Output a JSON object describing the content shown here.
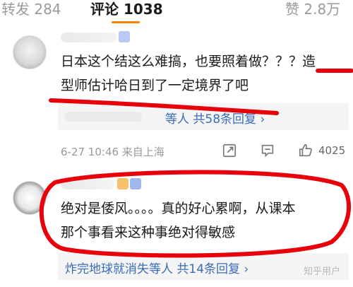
{
  "tabs": {
    "repost": "转发 284",
    "comments": "评论 1038",
    "likes": "赞 2.8万"
  },
  "comments": [
    {
      "text_line1": "日本这个结这么难搞，也要照着做？？？造",
      "text_line2": "型师估计哈日到了一定境界了吧",
      "reply_summary": "等人",
      "reply_count": "共58条回复",
      "time_location": "6-27 10:46 来自上海",
      "likes": "4025"
    },
    {
      "text_line1": "绝对是倭风。。。。真的好心累啊，从课本",
      "text_line2": "那个事看来这种事绝对得敏感",
      "reply_summary": "炸完地球就消失等人",
      "reply_count": "共14条回复"
    }
  ],
  "watermark": "知乎用户",
  "colors": {
    "accent": "#ff8200",
    "link": "#3a6cb6",
    "annotation": "#e8000b"
  },
  "icons": [
    "share-icon",
    "comment-icon",
    "thumbs-up-icon",
    "chevron-down-icon"
  ]
}
